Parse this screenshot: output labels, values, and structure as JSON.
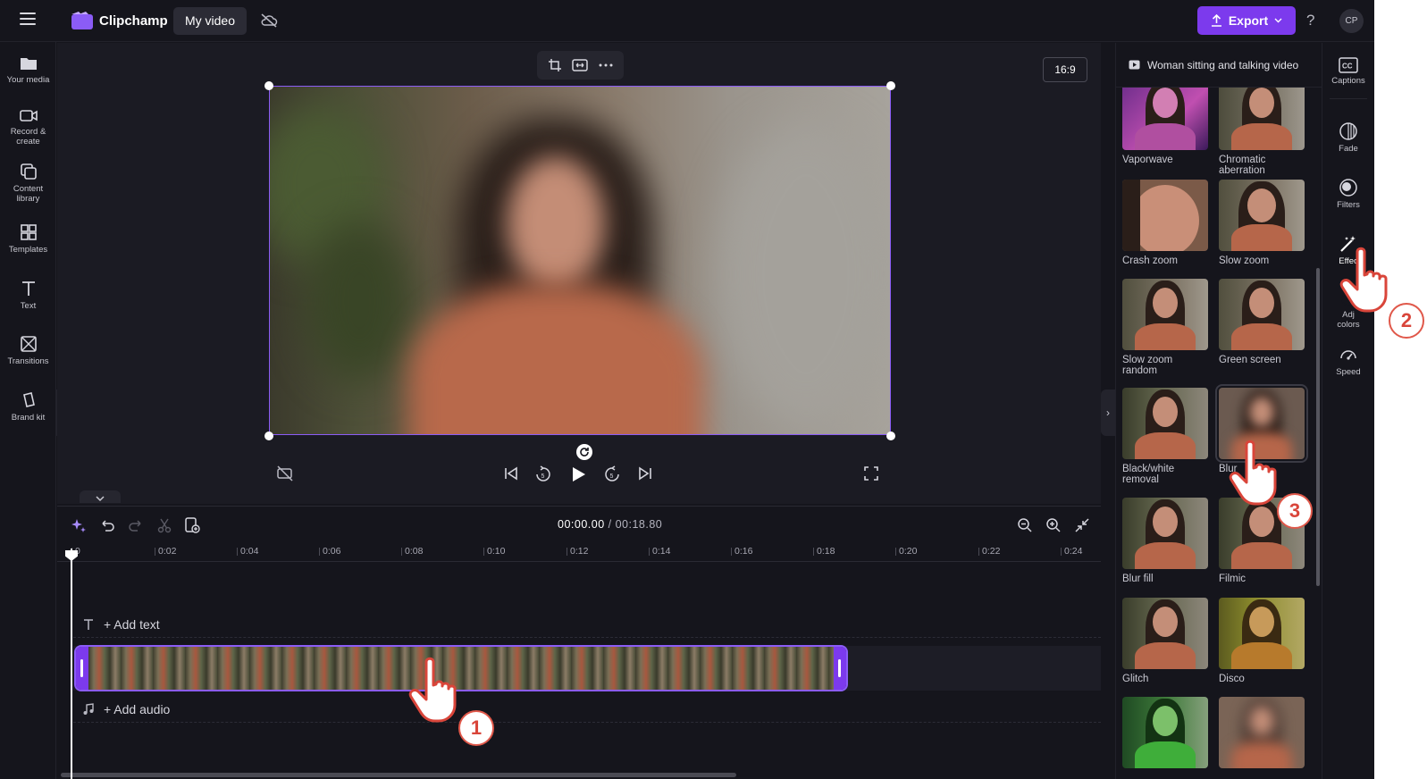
{
  "app": {
    "name": "Clipchamp",
    "project_title": "My video",
    "export_label": "Export",
    "help": "?",
    "avatar_initials": "CP",
    "accent": "#7c3aed"
  },
  "left_nav": [
    {
      "label": "Your media",
      "icon": "folder-icon"
    },
    {
      "label": "Record &\ncreate",
      "icon": "camera-icon"
    },
    {
      "label": "Content\nlibrary",
      "icon": "library-icon"
    },
    {
      "label": "Templates",
      "icon": "templates-icon"
    },
    {
      "label": "Text",
      "icon": "text-icon"
    },
    {
      "label": "Transitions",
      "icon": "transitions-icon"
    },
    {
      "label": "Brand kit",
      "icon": "brand-kit-icon"
    }
  ],
  "preview": {
    "aspect_ratio": "16:9"
  },
  "timeline": {
    "current_time": "00:00.00",
    "total_time": "/ 00:18.80",
    "ruler_ticks": [
      "0",
      "0:02",
      "0:04",
      "0:06",
      "0:08",
      "0:10",
      "0:12",
      "0:14",
      "0:16",
      "0:18",
      "0:20",
      "0:22",
      "0:24"
    ],
    "add_text": "+ Add text",
    "add_audio": "+ Add audio"
  },
  "effects_panel": {
    "clip_name": "Woman sitting and talking video",
    "effects": [
      {
        "label": "Vaporwave"
      },
      {
        "label": "Chromatic\naberration"
      },
      {
        "label": "Crash zoom"
      },
      {
        "label": "Slow zoom"
      },
      {
        "label": "Slow zoom\nrandom"
      },
      {
        "label": "Green screen"
      },
      {
        "label": "Black/white\nremoval"
      },
      {
        "label": "Blur"
      },
      {
        "label": "Blur fill"
      },
      {
        "label": "Filmic"
      },
      {
        "label": "Glitch"
      },
      {
        "label": "Disco"
      }
    ]
  },
  "right_rail": [
    {
      "label": "Captions",
      "icon": "captions-icon"
    },
    {
      "label": "Fade",
      "icon": "fade-icon"
    },
    {
      "label": "Filters",
      "icon": "filters-icon"
    },
    {
      "label": "Effec",
      "icon": "effects-wand-icon"
    },
    {
      "label": "Adj\ncolors",
      "icon": "adjust-colors-icon"
    },
    {
      "label": "Speed",
      "icon": "speed-icon"
    }
  ],
  "step_badges": [
    "1",
    "2",
    "3"
  ]
}
